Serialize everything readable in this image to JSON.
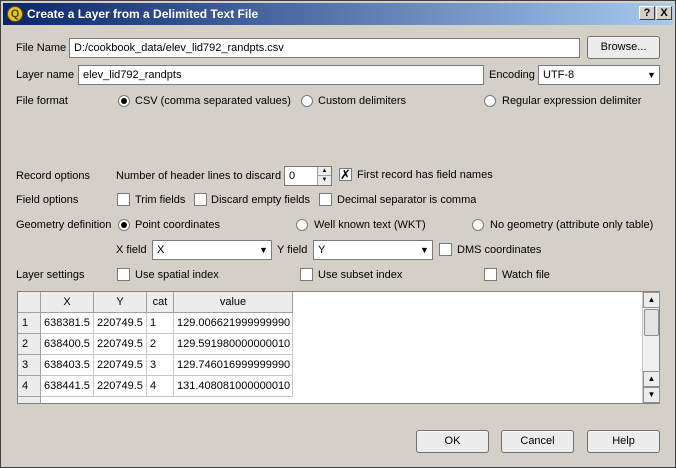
{
  "window": {
    "title": "Create a Layer from a Delimited Text File",
    "help_btn": "?",
    "close_btn": "X"
  },
  "file": {
    "label": "File Name",
    "value": "D:/cookbook_data/elev_lid792_randpts.csv",
    "browse_label": "Browse..."
  },
  "layer": {
    "label": "Layer name",
    "value": "elev_lid792_randpts",
    "encoding_label": "Encoding",
    "encoding_value": "UTF-8"
  },
  "file_format": {
    "label": "File format",
    "options": [
      "CSV (comma separated values)",
      "Custom delimiters",
      "Regular expression delimiter"
    ],
    "selected": 0
  },
  "record_options": {
    "label": "Record options",
    "header_lines_label": "Number of header lines to discard",
    "header_lines_value": "0",
    "first_record_label": "First record has field names",
    "first_record_checked": true
  },
  "field_options": {
    "label": "Field options",
    "trim_label": "Trim fields",
    "discard_empty_label": "Discard empty fields",
    "decimal_comma_label": "Decimal separator is comma"
  },
  "geometry": {
    "label": "Geometry definition",
    "options": [
      "Point coordinates",
      "Well known text (WKT)",
      "No geometry (attribute only table)"
    ],
    "selected": 0,
    "x_field_label": "X field",
    "x_field_value": "X",
    "y_field_label": "Y field",
    "y_field_value": "Y",
    "dms_label": "DMS coordinates"
  },
  "layer_settings": {
    "label": "Layer settings",
    "spatial_index_label": "Use spatial index",
    "subset_index_label": "Use subset index",
    "watch_file_label": "Watch file"
  },
  "table": {
    "columns": [
      "X",
      "Y",
      "cat",
      "value"
    ],
    "rows": [
      {
        "num": "1",
        "cells": [
          "638381.5",
          "220749.5",
          "1",
          "129.006621999999990"
        ]
      },
      {
        "num": "2",
        "cells": [
          "638400.5",
          "220749.5",
          "2",
          "129.591980000000010"
        ]
      },
      {
        "num": "3",
        "cells": [
          "638403.5",
          "220749.5",
          "3",
          "129.746016999999990"
        ]
      },
      {
        "num": "4",
        "cells": [
          "638441.5",
          "220749.5",
          "4",
          "131.408081000000010"
        ]
      }
    ]
  },
  "buttons": {
    "ok": "OK",
    "cancel": "Cancel",
    "help": "Help"
  }
}
